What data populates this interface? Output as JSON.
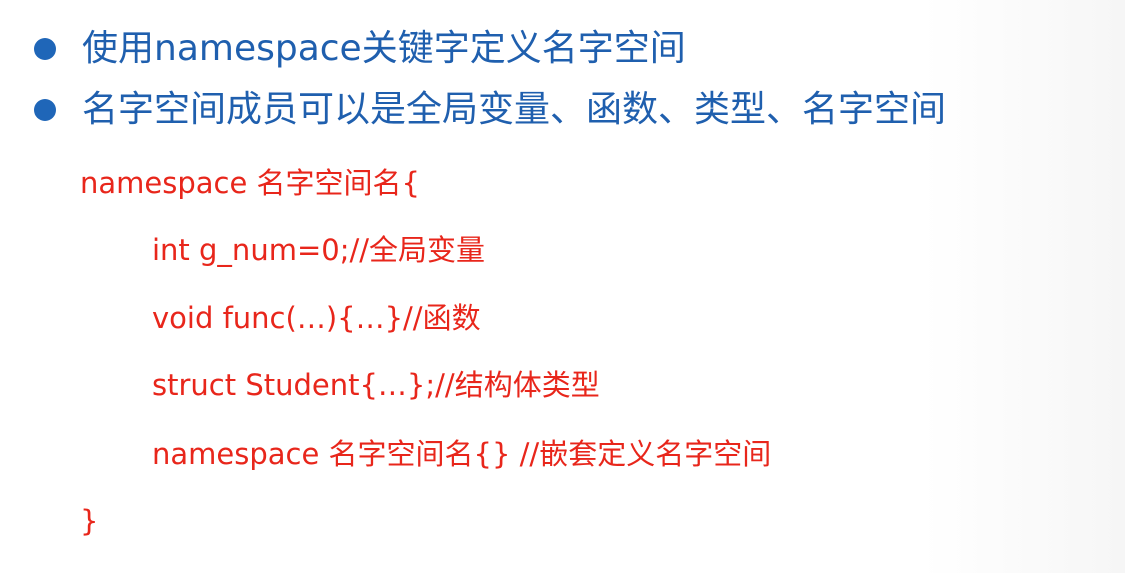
{
  "bullets": [
    {
      "text": "使用namespace关键字定义名字空间",
      "icon": "bullet-dot"
    },
    {
      "text": "名字空间成员可以是全局变量、函数、类型、名字空间",
      "icon": "bullet-dot"
    }
  ],
  "code": {
    "lines": [
      "namespace 名字空间名{",
      "int g_num=0;//全局变量",
      "void func(…){…}//函数",
      "struct Student{…};//结构体类型",
      "namespace 名字空间名{} //嵌套定义名字空间",
      "}"
    ]
  },
  "colors": {
    "bullet_text": "#1f5fae",
    "bullet_dot": "#1f66b8",
    "code_text": "#e8261b",
    "background": "#ffffff"
  }
}
